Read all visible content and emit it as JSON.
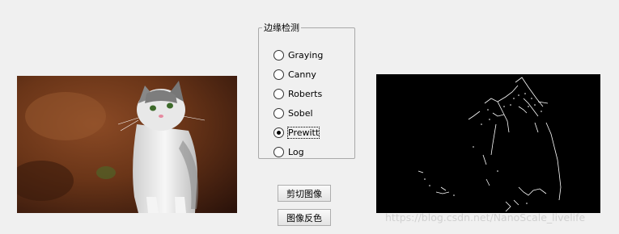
{
  "groupbox": {
    "title": "边缘检测",
    "options": [
      {
        "label": "Graying",
        "checked": false
      },
      {
        "label": "Canny",
        "checked": false
      },
      {
        "label": "Roberts",
        "checked": false
      },
      {
        "label": "Sobel",
        "checked": false
      },
      {
        "label": "Prewitt",
        "checked": true
      },
      {
        "label": "Log",
        "checked": false
      }
    ]
  },
  "buttons": {
    "crop_label": "剪切图像",
    "invert_label": "图像反色"
  },
  "watermark": "https://blog.csdn.net/NanoScale_livelife",
  "colors": {
    "background": "#f0f0f0",
    "edge_panel": "#000000",
    "photo_bg": "#6a3518"
  }
}
